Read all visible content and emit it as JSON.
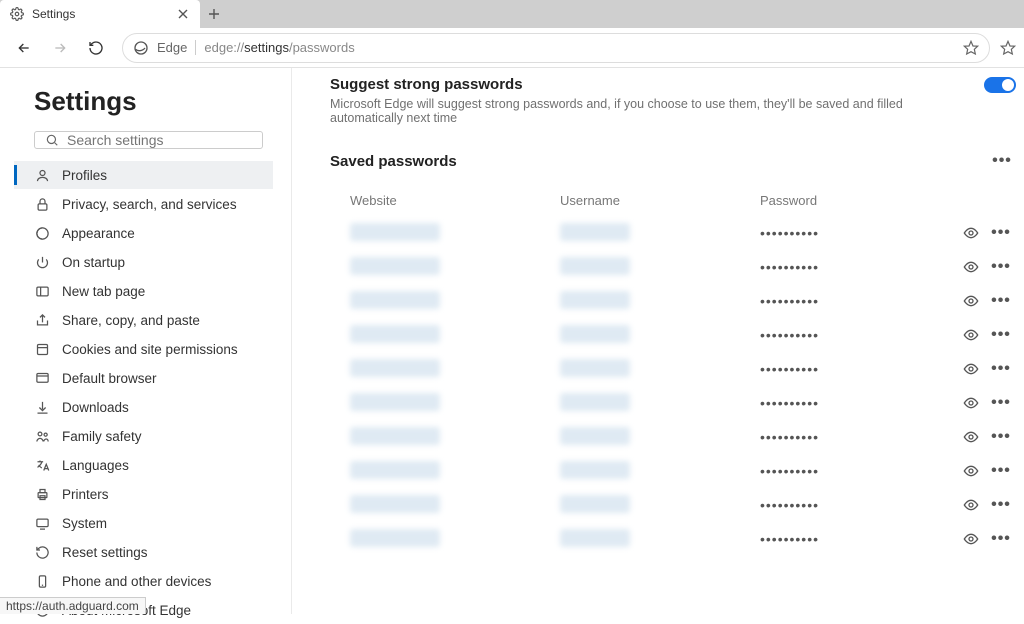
{
  "tabstrip": {
    "tab_title": "Settings"
  },
  "browser_identity": {
    "label": "Edge"
  },
  "address": {
    "prefix": "edge://",
    "strong": "settings",
    "suffix": "/passwords"
  },
  "settings": {
    "title": "Settings",
    "search_placeholder": "Search settings"
  },
  "nav": {
    "items": [
      {
        "label": "Profiles"
      },
      {
        "label": "Privacy, search, and services"
      },
      {
        "label": "Appearance"
      },
      {
        "label": "On startup"
      },
      {
        "label": "New tab page"
      },
      {
        "label": "Share, copy, and paste"
      },
      {
        "label": "Cookies and site permissions"
      },
      {
        "label": "Default browser"
      },
      {
        "label": "Downloads"
      },
      {
        "label": "Family safety"
      },
      {
        "label": "Languages"
      },
      {
        "label": "Printers"
      },
      {
        "label": "System"
      },
      {
        "label": "Reset settings"
      },
      {
        "label": "Phone and other devices"
      },
      {
        "label": "About Microsoft Edge"
      }
    ]
  },
  "main": {
    "suggest_title": "Suggest strong passwords",
    "suggest_desc": "Microsoft Edge will suggest strong passwords and, if you choose to use them, they'll be saved and filled automatically next time",
    "saved_title": "Saved passwords",
    "columns": {
      "website": "Website",
      "username": "Username",
      "password": "Password"
    },
    "rows": [
      {
        "password_mask": "••••••••••"
      },
      {
        "password_mask": "••••••••••"
      },
      {
        "password_mask": "••••••••••"
      },
      {
        "password_mask": "••••••••••"
      },
      {
        "password_mask": "••••••••••"
      },
      {
        "password_mask": "••••••••••"
      },
      {
        "password_mask": "••••••••••"
      },
      {
        "password_mask": "••••••••••"
      },
      {
        "password_mask": "••••••••••"
      },
      {
        "password_mask": "••••••••••"
      }
    ]
  },
  "status": {
    "hover_url": "https://auth.adguard.com"
  }
}
